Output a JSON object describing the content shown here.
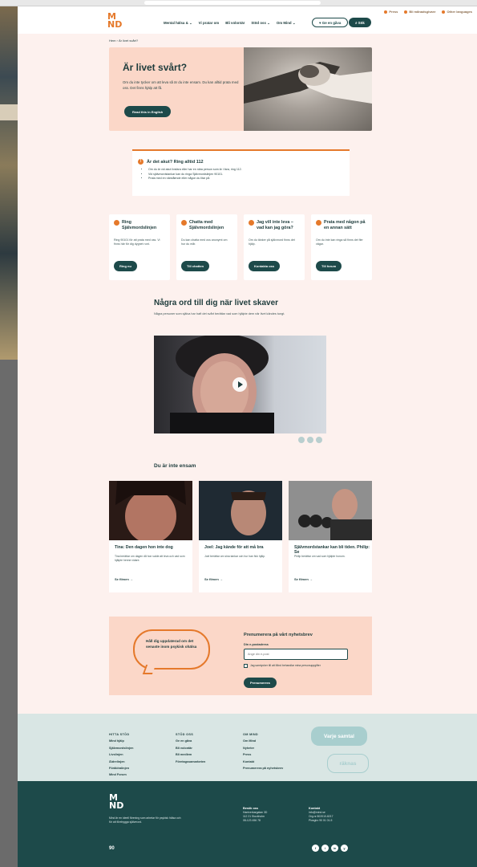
{
  "browser": {},
  "header": {
    "top_links": [
      "Press",
      "Bli månadsgivare",
      "Other languages"
    ],
    "nav": [
      "Mental hälsa & ⌄",
      "Vi pratar om",
      "Bli volontär",
      "Stöd oss ⌄",
      "Om Mind ⌄"
    ],
    "ge_en_gava": "♥ Ge en gåva",
    "search": "⌕ Sök"
  },
  "breadcrumb": "Hem  ›  Är livet svårt?",
  "hero": {
    "title": "Är livet svårt?",
    "text": "Om du inte tycker om att leva så är du inte ensam. Du kan alltid prata med oss. Det finns hjälp att få.",
    "button": "Read this in English"
  },
  "alert": {
    "title": "Är det akut? Ring alltid 112",
    "items": [
      "Om du är vid akut livsfara eller har en nära person som är i fara, ring 112.",
      "Vid självmordstankar kan du ringa Självmordslinjen 90101.",
      "Prata med en närstående eller någon du litar på."
    ]
  },
  "cards": [
    {
      "title": "Ring Självmordslinjen",
      "text": "Ring 90101 för att prata med oss. Vi finns här för dig dygnet runt.",
      "button": "Ring nu"
    },
    {
      "title": "Chatta med Självmordslinjen",
      "text": "Du kan chatta med oss anonymt om hur du mår.",
      "button": "Till chatten"
    },
    {
      "title": "Jag vill inte leva – vad kan jag göra?",
      "text": "Om du tänker på självmord finns det hjälp.",
      "button": "Kontakta oss"
    },
    {
      "title": "Prata med någon på en annan sätt",
      "text": "Om du inte kan ringa så finns det fler vägar.",
      "button": "Till forum"
    }
  ],
  "words": {
    "title": "Några ord till dig när livet skaver",
    "intro": "Några personer som själva har haft det svårt berättar vad som hjälpte dem när livet kändes tungt."
  },
  "alone": {
    "title": "Du är inte ensam",
    "stories": [
      {
        "title": "Tina: Den dagen hon inte dog",
        "text": "Tina berättar om dagen då hon valde att leva och vad som hjälpte henne vidare.",
        "link": "Se filmen →"
      },
      {
        "title": "Joel: Jag kände för att må bra",
        "text": "Joel berättar om sina tankar och hur han fick hjälp.",
        "link": "Se filmen →"
      },
      {
        "title": "Självmordstankar kan bli tiden. Philip: Se",
        "text": "Philip berättar om vad som hjälpte honom.",
        "link": "Se filmen →"
      }
    ]
  },
  "newsletter": {
    "bubble": "Håll dig uppdaterad om det senaste inom psykisk ohälsa",
    "title": "Prenumerera på vårt nyhetsbrev",
    "email_label": "Din e-postadress",
    "email_placeholder": "Ange din e-post",
    "consent": "Jag samtycker till att Mind behandlar mina personuppgifter",
    "button": "Prenumerera"
  },
  "footer_light": {
    "cols": [
      {
        "head": "HITTA STÖD",
        "items": [
          "Mind hjälp",
          "Självmordslinjen",
          "Livslinjen",
          "Äldrelinjen",
          "Föräldralinjen",
          "Mind Forum"
        ]
      },
      {
        "head": "STÖD OSS",
        "items": [
          "Ge en gåva",
          "Bli volontär",
          "Bli medlem",
          "Företagssamarbeten"
        ]
      },
      {
        "head": "OM MIND",
        "items": [
          "Om Mind",
          "Nyheter",
          "Press",
          "Kontakt",
          "Prenumerera på nyhetsbrev"
        ]
      }
    ],
    "bubble1": "Varje samtal",
    "bubble2": "räknas"
  },
  "footer_dark": {
    "logo": "M\nND",
    "about": "Mind är en ideell förening som arbetar för psykisk hälsa och för att förebygga självmord.",
    "badge": "90",
    "visit_title": "Besök oss",
    "visit_lines": [
      "Hantverkargatan 3D",
      "112 21 Stockholm",
      "08-123 456 78"
    ],
    "office_title": "Kontakt",
    "office_lines": [
      "info@mind.se",
      "Org.nr 802010-8217",
      "Plusgiro 90 01 01-5"
    ],
    "socials": [
      "f",
      "i",
      "in",
      "y"
    ]
  }
}
